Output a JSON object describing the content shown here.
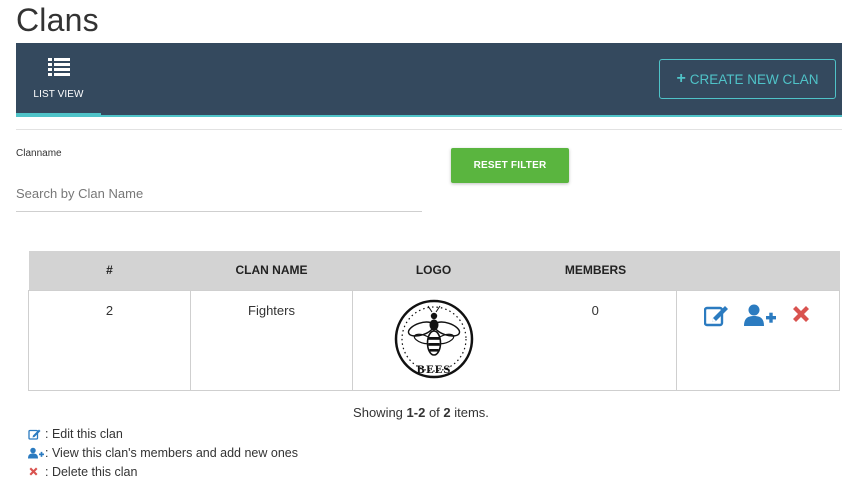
{
  "page": {
    "title": "Clans"
  },
  "topbar": {
    "tab_list_label": "LIST VIEW",
    "create_button_label": "CREATE NEW CLAN"
  },
  "filter": {
    "label": "Clanname",
    "placeholder": "Search by Clan Name",
    "value": "",
    "reset_button_label": "RESET FILTER"
  },
  "table": {
    "columns": [
      "#",
      "CLAN NAME",
      "LOGO",
      "MEMBERS",
      ""
    ],
    "rows": [
      {
        "id": "2",
        "name": "Fighters",
        "logo_text": "BEES",
        "members": "0"
      }
    ]
  },
  "pagination": {
    "prefix": "Showing ",
    "range": "1-2",
    "middle": " of ",
    "total": "2",
    "suffix": " items."
  },
  "legend": {
    "edit": ": Edit this clan",
    "members": ": View this clan's members and add new ones",
    "delete": ": Delete this clan"
  },
  "colors": {
    "topbar": "#34495e",
    "accent": "#4fc3c8",
    "reset_button": "#5ab53f",
    "action_blue": "#2b7bc0",
    "delete_red": "#d9534f"
  },
  "icons": {
    "list": "list-icon",
    "edit": "edit-icon",
    "add_member": "add-member-icon",
    "delete": "delete-icon"
  }
}
